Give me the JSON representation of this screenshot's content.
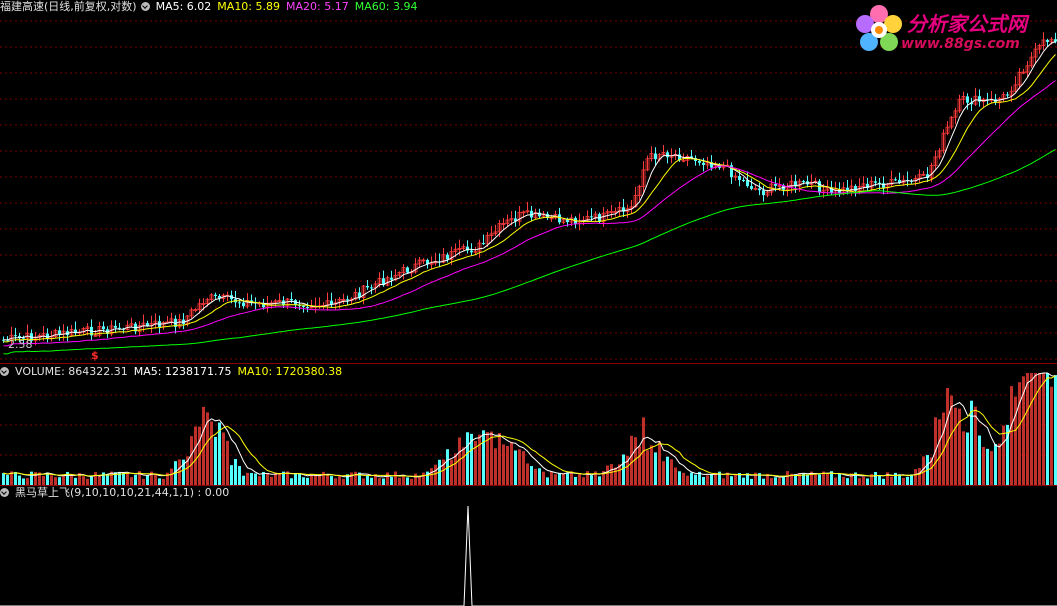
{
  "main_header": {
    "title": "福建高速(日线,前复权,对数)",
    "ma5": "MA5: 6.02",
    "ma10": "MA10: 5.89",
    "ma20": "MA20: 5.17",
    "ma60": "MA60: 3.94"
  },
  "volume_header": {
    "label": "VOLUME: 864322.31",
    "ma5": "MA5: 1238171.75",
    "ma10": "MA10: 1720380.38"
  },
  "indicator_header": {
    "label": "黑马草上飞(9,10,10,10,21,44,1,1) : 0.00"
  },
  "price_marker": "2.58",
  "signal_marker": "$",
  "logo": {
    "title": "分析家公式网",
    "url": "www.88gs.com"
  },
  "colors": {
    "up": "#ff3b3b",
    "down": "#54ffff",
    "ma5": "#ffffff",
    "ma10": "#ffff00",
    "ma20": "#ff00ff",
    "ma60": "#00ff00",
    "grid": "#7a0000"
  },
  "chart_data": {
    "type": "candlestick",
    "ma_values": {
      "MA5": 6.02,
      "MA10": 5.89,
      "MA20": 5.17,
      "MA60": 3.94
    },
    "volume": 864322.31,
    "volume_ma5": 1238171.75,
    "volume_ma10": 1720380.38,
    "indicator_value": 0.0
  }
}
